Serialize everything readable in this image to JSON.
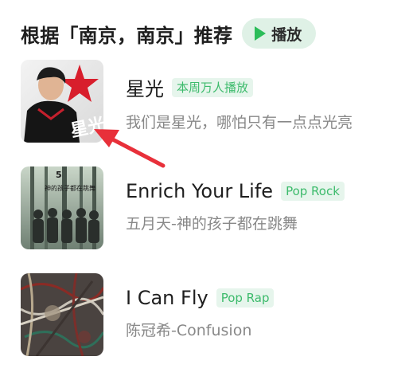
{
  "header": {
    "title": "根据「南京，南京」推荐",
    "play_label": "播放"
  },
  "colors": {
    "accent_green": "#2bbd59",
    "tag_text": "#3dbb6c",
    "tag_bg": "#e6f5ec",
    "pill_bg": "#dff1e6",
    "annotation_arrow": "#e8303a"
  },
  "songs": [
    {
      "title": "星光",
      "tag": "本周万人播放",
      "subtitle": "我们是星光，哪怕只有一点点光亮",
      "cover_text": "星光"
    },
    {
      "title": "Enrich Your Life",
      "tag": "Pop Rock",
      "subtitle": "五月天-神的孩子都在跳舞",
      "cover_text": "神的孩子都在跳舞"
    },
    {
      "title": "I Can Fly",
      "tag": "Pop Rap",
      "subtitle": "陈冠希-Confusion"
    }
  ]
}
